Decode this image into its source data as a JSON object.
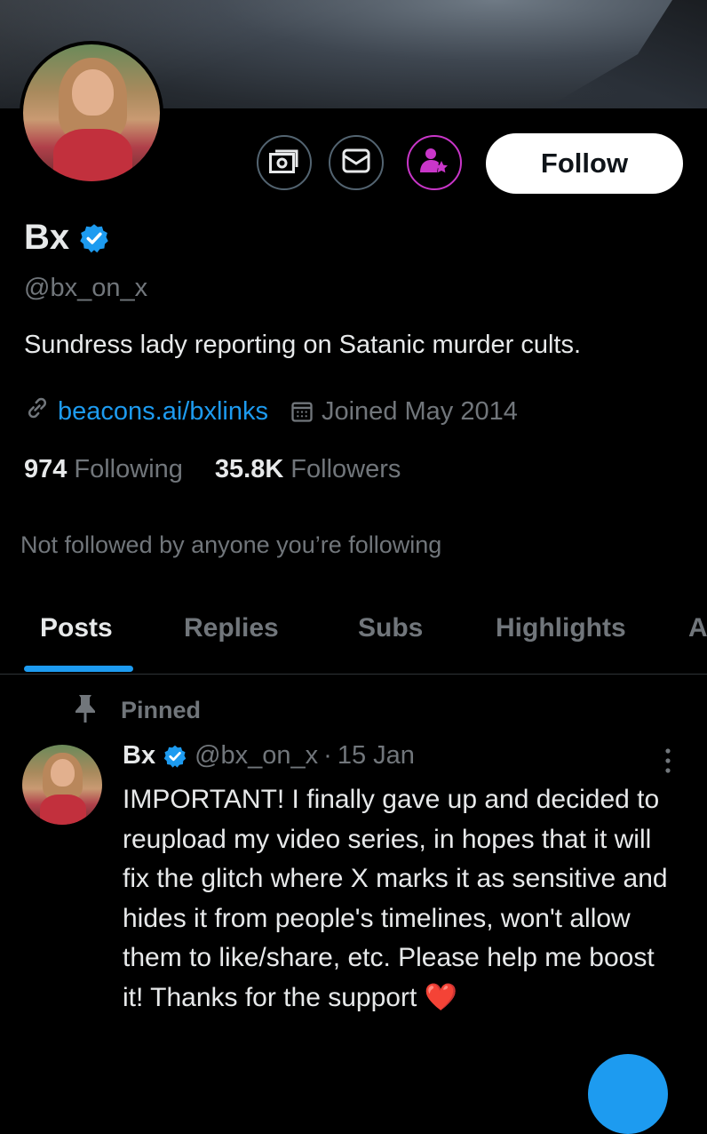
{
  "profile": {
    "display_name": "Bx",
    "handle": "@bx_on_x",
    "bio": "Sundress lady reporting on Satanic murder cults.",
    "link": "beacons.ai/bxlinks",
    "joined": "Joined May 2014",
    "following_count": "974",
    "following_label": "Following",
    "followers_count": "35.8K",
    "followers_label": "Followers",
    "not_followed_text": "Not followed by anyone you’re following"
  },
  "actions": {
    "follow_label": "Follow"
  },
  "tabs": [
    {
      "label": "Posts",
      "active": true
    },
    {
      "label": "Replies",
      "active": false
    },
    {
      "label": "Subs",
      "active": false
    },
    {
      "label": "Highlights",
      "active": false
    },
    {
      "label": "A",
      "active": false
    }
  ],
  "pinned_post": {
    "pinned_label": "Pinned",
    "author_name": "Bx",
    "author_handle": "@bx_on_x",
    "separator": "·",
    "date": "15 Jan",
    "text": "IMPORTANT! I finally gave up and decided to reupload my video series, in hopes that it will fix the glitch where X marks it as sensitive and hides it from people's timelines, won't allow them to like/share, etc. Please help me boost it! Thanks for the support",
    "emoji": "❤️"
  },
  "icons": {
    "money": "money-icon",
    "message": "envelope-icon",
    "subscribe": "person-star-icon",
    "verified": "verified-badge-icon",
    "link": "link-icon",
    "calendar": "calendar-icon",
    "pin": "pin-icon",
    "more": "more-vertical-icon"
  },
  "colors": {
    "accent": "#1d9bf0",
    "subscribe": "#c936c9",
    "muted": "#71767b",
    "background": "#000000"
  }
}
